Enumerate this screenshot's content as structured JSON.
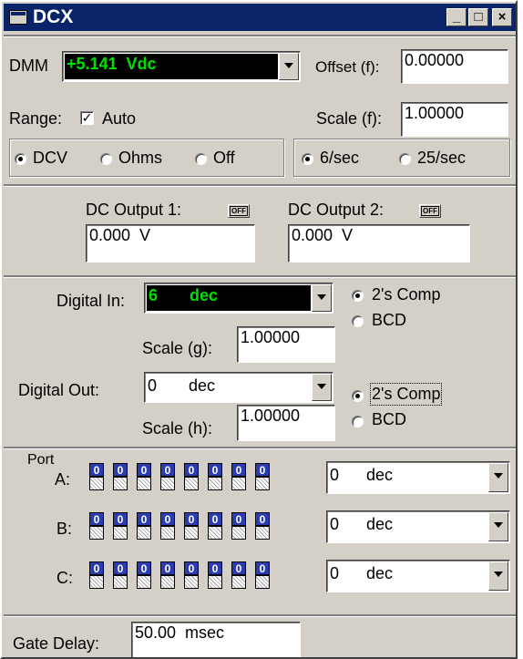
{
  "window": {
    "title": "DCX",
    "minimize": "_",
    "maximize": "□",
    "close": "×"
  },
  "dmm": {
    "label": "DMM",
    "reading": "+5.141  Vdc",
    "offset_label": "Offset (f):",
    "offset_value": "0.00000",
    "range_label": "Range:",
    "auto_label": "Auto",
    "auto_checked": true,
    "scale_label": "Scale (f):",
    "scale_value": "1.00000",
    "modes": [
      "DCV",
      "Ohms",
      "Off"
    ],
    "mode_selected": "DCV",
    "rates": [
      "6/sec",
      "25/sec"
    ],
    "rate_selected": "6/sec"
  },
  "dc_outputs": {
    "out1_label": "DC Output 1:",
    "out1_button": "OFF",
    "out1_value": "0.000  V",
    "out2_label": "DC Output 2:",
    "out2_button": "OFF",
    "out2_value": "0.000  V"
  },
  "digital": {
    "in_label": "Digital In:",
    "in_value": "6       dec",
    "in_format_options": [
      "2's Comp",
      "BCD"
    ],
    "in_format_selected": "2's Comp",
    "scale_g_label": "Scale (g):",
    "scale_g_value": "1.00000",
    "out_label": "Digital Out:",
    "out_value": "0       dec",
    "out_format_options": [
      "2's Comp",
      "BCD"
    ],
    "out_format_selected": "2's Comp",
    "scale_h_label": "Scale (h):",
    "scale_h_value": "1.00000"
  },
  "ports": {
    "port_label": "Port",
    "rows": [
      {
        "label": "A:",
        "bits": [
          "0",
          "0",
          "0",
          "0",
          "0",
          "0",
          "0",
          "0"
        ],
        "value": "0      dec"
      },
      {
        "label": "B:",
        "bits": [
          "0",
          "0",
          "0",
          "0",
          "0",
          "0",
          "0",
          "0"
        ],
        "value": "0      dec"
      },
      {
        "label": "C:",
        "bits": [
          "0",
          "0",
          "0",
          "0",
          "0",
          "0",
          "0",
          "0"
        ],
        "value": "0      dec"
      }
    ]
  },
  "gate": {
    "label": "Gate Delay:",
    "value": "50.00  msec"
  },
  "colors": {
    "titlebar": "#0a246a",
    "dmm_display_bg": "#000000",
    "dmm_display_fg": "#00e000",
    "bit_on": "#2b3cb0"
  }
}
